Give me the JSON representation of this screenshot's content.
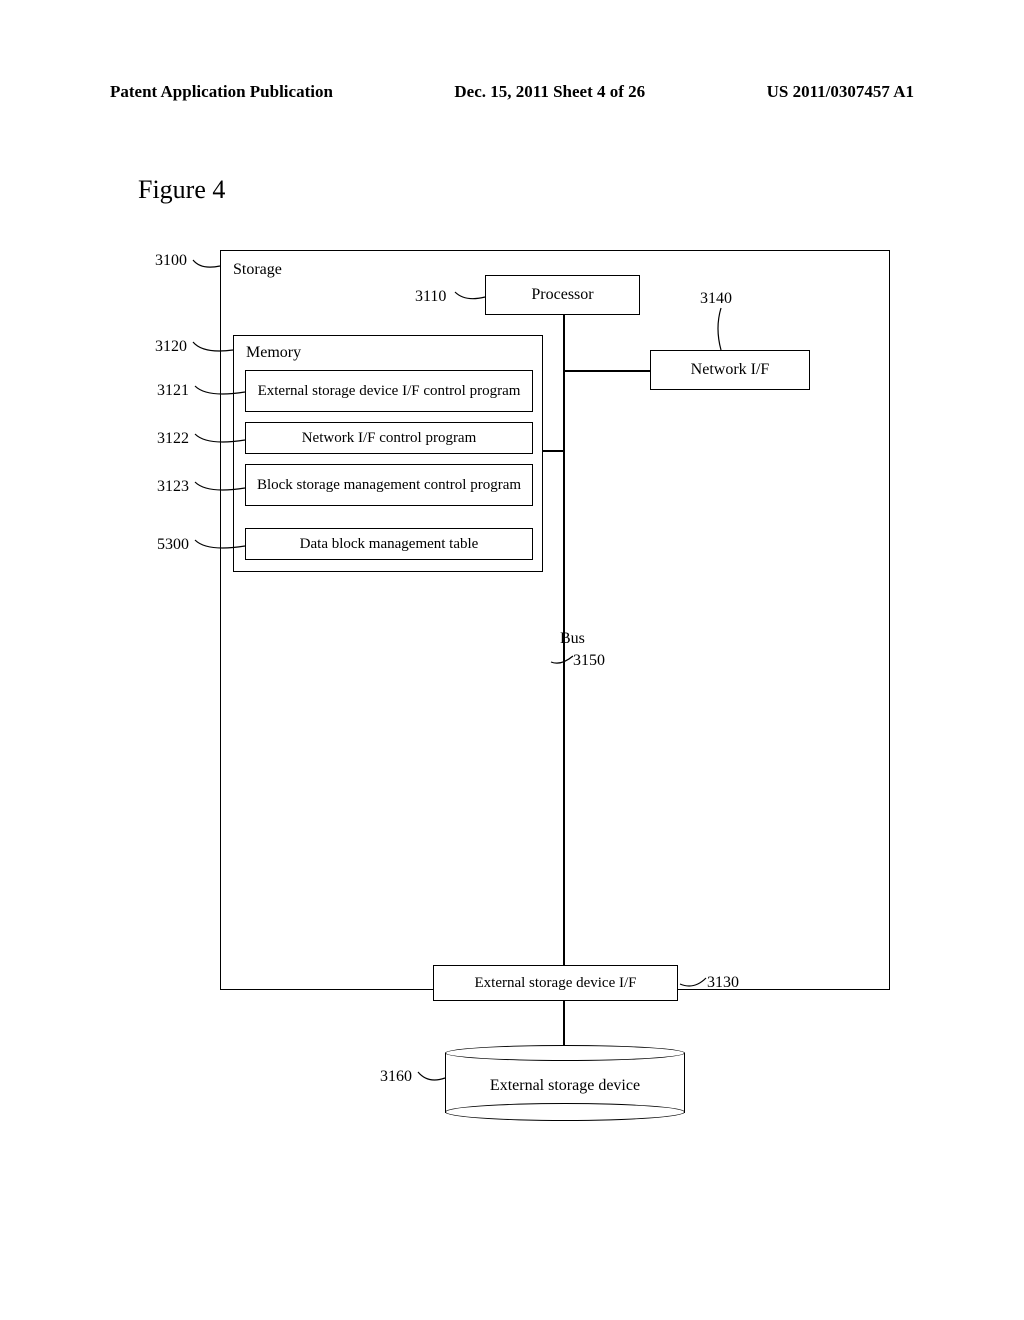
{
  "header": {
    "left": "Patent Application Publication",
    "center": "Dec. 15, 2011  Sheet 4 of 26",
    "right": "US 2011/0307457 A1"
  },
  "figure_title": "Figure 4",
  "refs": {
    "r3100": "3100",
    "r3110": "3110",
    "r3120": "3120",
    "r3121": "3121",
    "r3122": "3122",
    "r3123": "3123",
    "r5300": "5300",
    "r3140": "3140",
    "r3150": "3150",
    "r3130": "3130",
    "r3160": "3160"
  },
  "labels": {
    "storage": "Storage",
    "processor": "Processor",
    "memory": "Memory",
    "ext_prog": "External storage device I/F control program",
    "net_prog": "Network I/F control program",
    "block_prog": "Block storage management control program",
    "data_table": "Data block management table",
    "net_if": "Network I/F",
    "bus": "Bus",
    "ext_if": "External storage device I/F",
    "ext_dev": "External storage device"
  }
}
